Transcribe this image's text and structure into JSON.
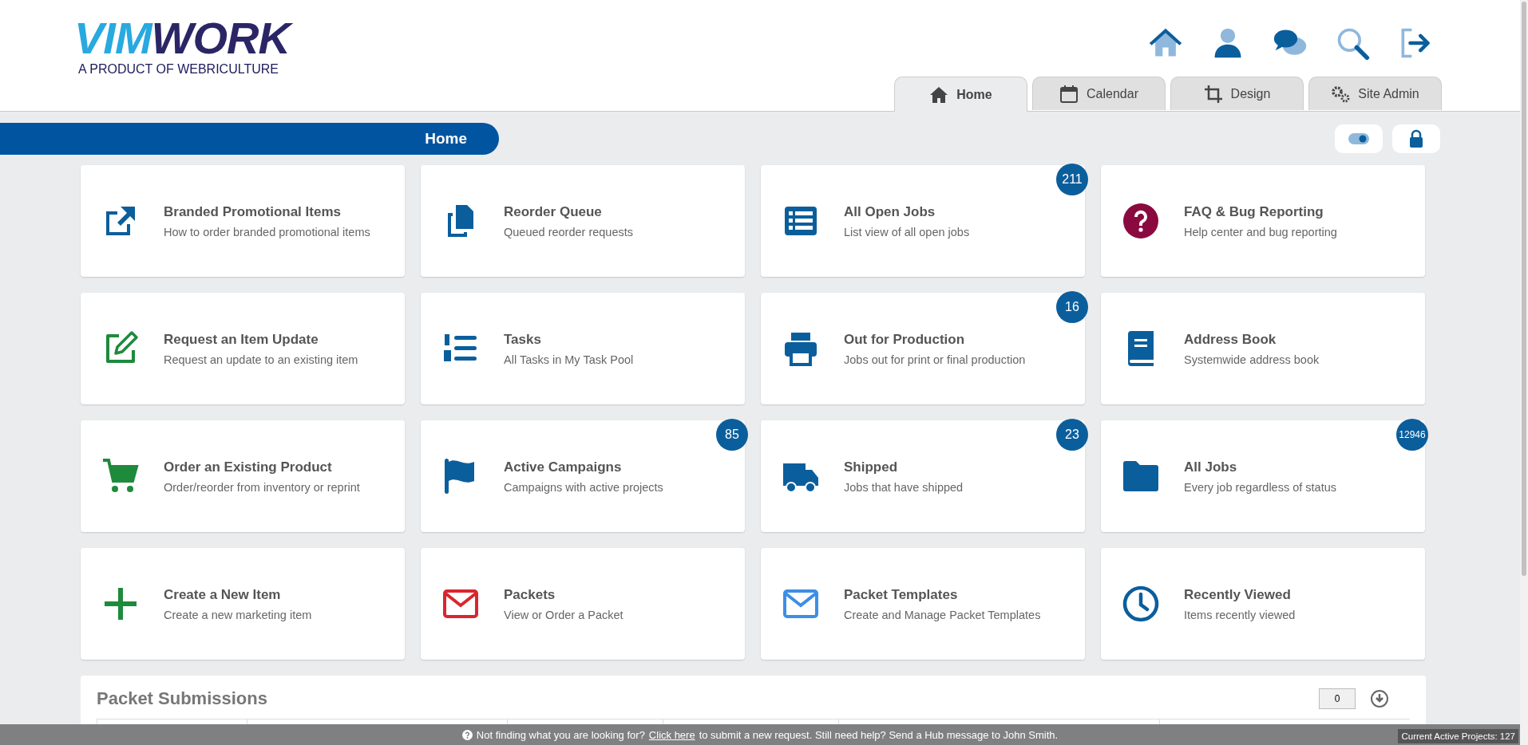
{
  "logo": {
    "name_light": "VIM",
    "name_dark": "WORK",
    "tagline": "A PRODUCT OF WEBRICULTURE"
  },
  "tabs": [
    {
      "label": "Home",
      "selected": true
    },
    {
      "label": "Calendar",
      "selected": false
    },
    {
      "label": "Design",
      "selected": false
    },
    {
      "label": "Site Admin",
      "selected": false
    }
  ],
  "page_title": "Home",
  "view_toggle": {
    "on": true
  },
  "cards": [
    {
      "title": "Branded Promotional Items",
      "subtitle": "How to order branded promotional items",
      "color": "#0b5e9c"
    },
    {
      "title": "Reorder Queue",
      "subtitle": "Queued reorder requests",
      "color": "#0b5e9c"
    },
    {
      "title": "All Open Jobs",
      "subtitle": "List view of all open jobs",
      "badge": "211",
      "color": "#0b5e9c"
    },
    {
      "title": "FAQ & Bug Reporting",
      "subtitle": "Help center and bug reporting",
      "color": "#8a0a40"
    },
    {
      "title": "Request an Item Update",
      "subtitle": "Request an update to an existing item",
      "color": "#1e8a3c"
    },
    {
      "title": "Tasks",
      "subtitle": "All Tasks in My Task Pool",
      "color": "#0b5e9c"
    },
    {
      "title": "Out for Production",
      "subtitle": "Jobs out for print or final production",
      "badge": "16",
      "color": "#0b5e9c"
    },
    {
      "title": "Address Book",
      "subtitle": "Systemwide address book",
      "color": "#0b5e9c"
    },
    {
      "title": "Order an Existing Product",
      "subtitle": "Order/reorder from inventory or reprint",
      "color": "#1e8a3c"
    },
    {
      "title": "Active Campaigns",
      "subtitle": "Campaigns with active projects",
      "badge": "85",
      "color": "#0b5e9c"
    },
    {
      "title": "Shipped",
      "subtitle": "Jobs that have shipped",
      "badge": "23",
      "color": "#0b5e9c"
    },
    {
      "title": "All Jobs",
      "subtitle": "Every job regardless of status",
      "badge": "12946",
      "color": "#0b5e9c"
    },
    {
      "title": "Create a New Item",
      "subtitle": "Create a new marketing item",
      "color": "#1e8a3c"
    },
    {
      "title": "Packets",
      "subtitle": "View or Order a Packet",
      "color": "#d9262e"
    },
    {
      "title": "Packet Templates",
      "subtitle": "Create and Manage Packet Templates",
      "color": "#3d8ee6"
    },
    {
      "title": "Recently Viewed",
      "subtitle": "Items recently viewed",
      "color": "#0b5e9c"
    }
  ],
  "packet_submissions": {
    "title": "Packet Submissions",
    "count": "0"
  },
  "footer": {
    "before": "Not finding what you are looking for?",
    "link": "Click here",
    "after": "to submit a new request. Still need help? Send a Hub message to John Smith.",
    "active_projects": "Current Active Projects: 127"
  }
}
